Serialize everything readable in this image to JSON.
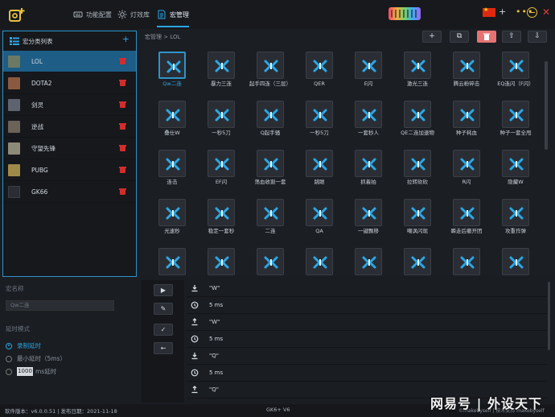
{
  "topbar": {
    "tabs": [
      {
        "label": "功能配置",
        "icon": "keyboard-icon"
      },
      {
        "label": "灯效库",
        "icon": "sun-icon"
      },
      {
        "label": "宏管理",
        "icon": "document-icon"
      }
    ],
    "active_tab": 2,
    "accent": "#2aa7e6"
  },
  "macro_list": {
    "title": "宏分类列表",
    "add_label": "+",
    "items": [
      {
        "label": "LOL",
        "selected": true
      },
      {
        "label": "DOTA2"
      },
      {
        "label": "剑灵"
      },
      {
        "label": "逆战"
      },
      {
        "label": "守望先锋"
      },
      {
        "label": "PUBG"
      },
      {
        "label": "GK66"
      }
    ]
  },
  "main": {
    "breadcrumb": "宏管理 > LOL",
    "toolbar": [
      "+",
      "⧉",
      "🗑",
      "⇧",
      "⇩"
    ],
    "macros": [
      "Qw二连",
      "暴力三连",
      "起手四连（三层）",
      "QER",
      "E闪",
      "激光三连",
      "腾云粉碎击",
      "EQ连闪（F闪）",
      "叠仕W",
      "一秒5刀",
      "Q起手骚",
      "一秒5刀",
      "一套秒人",
      "QE二连加速物",
      "种子耗血",
      "种子一套全甩",
      "连击",
      "EF闪",
      "荡血收割一套",
      "跳眼",
      "抓着拍",
      "拉转砍砍",
      "R闪",
      "隐藏W",
      "光速秒",
      "稳定一套秒",
      "二连",
      "QA",
      "一键飘移",
      "嘲讽闪现",
      "瞬走后撤开团",
      "攻重作弹",
      "",
      "",
      "",
      "",
      "",
      "",
      "",
      ""
    ],
    "selected_index": 0
  },
  "settings": {
    "name_label": "宏名称",
    "name_value": "Qw二连",
    "delay_label": "延时模式",
    "options": [
      "录制延时",
      "最小延时（5ms）",
      "ms延时"
    ],
    "custom_ms": "1000",
    "selected_option": 0
  },
  "actions": [
    "▶",
    "✎",
    "✓",
    "←"
  ],
  "events": [
    {
      "type": "down",
      "value": "\"W\""
    },
    {
      "type": "delay",
      "value": "5 ms"
    },
    {
      "type": "up",
      "value": "\"W\""
    },
    {
      "type": "delay",
      "value": "5 ms"
    },
    {
      "type": "down",
      "value": "\"Q\""
    },
    {
      "type": "delay",
      "value": "5 ms"
    },
    {
      "type": "up",
      "value": "\"Q\""
    }
  ],
  "status": {
    "version": "软件版本：v6.0.0.51 | 发布日期：2021-11-18",
    "model": "GK6+ V6",
    "credit": "©makebyself | 技术支持 makebyself"
  },
  "watermark": "网易号 | 外设天下"
}
